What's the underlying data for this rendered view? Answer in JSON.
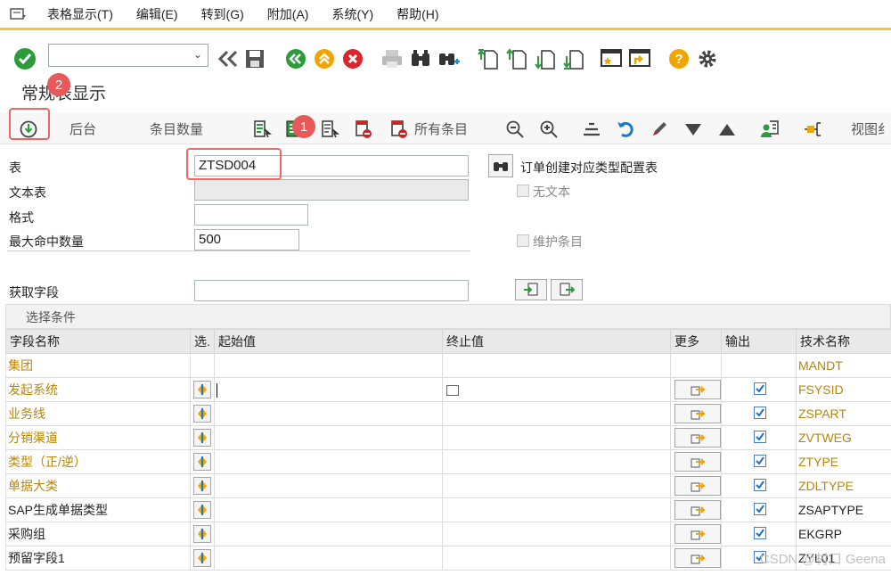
{
  "menu": {
    "items": [
      "表格显示(T)",
      "编辑(E)",
      "转到(G)",
      "附加(A)",
      "系统(Y)",
      "帮助(H)"
    ]
  },
  "toolbar": {
    "command_value": "",
    "icons": [
      "enter-icon",
      "back-icon",
      "save-icon",
      "green-back-icon",
      "exit-icon",
      "cancel-icon",
      "print-icon",
      "find-icon",
      "find-next-icon",
      "first-page-icon",
      "prev-page-icon",
      "next-page-icon",
      "last-page-icon",
      "new-session-icon",
      "shortcut-icon",
      "help-icon",
      "settings-icon"
    ]
  },
  "page_title": "常规表显示",
  "app_toolbar": {
    "background": "后台",
    "entry_count": "条目数量",
    "all_entries": "所有条目",
    "layout": "视图纟"
  },
  "form": {
    "table_label": "表",
    "table_value": "ZTSD004",
    "table_desc": "订单创建对应类型配置表",
    "text_table_label": "文本表",
    "text_table_value": "",
    "no_text_label": "无文本",
    "layout_label": "格式",
    "layout_value": "",
    "max_hits_label": "最大命中数量",
    "max_hits_value": "500",
    "maintain_label": "维护条目",
    "fetch_fields_label": "获取字段",
    "fetch_fields_value": ""
  },
  "badges": {
    "one": "1",
    "two": "2"
  },
  "selection": {
    "title": "选择条件",
    "headers": {
      "field_name": "字段名称",
      "sel": "选.",
      "from": "起始值",
      "to": "终止值",
      "more": "更多",
      "output": "输出",
      "tech_name": "技术名称"
    },
    "rows": [
      {
        "field": "集团",
        "tech": "MANDT",
        "req": true,
        "has_controls": false
      },
      {
        "field": "发起系统",
        "tech": "FSYSID",
        "req": true,
        "has_controls": true
      },
      {
        "field": "业务线",
        "tech": "ZSPART",
        "req": true,
        "has_controls": true
      },
      {
        "field": "分销渠道",
        "tech": "ZVTWEG",
        "req": true,
        "has_controls": true
      },
      {
        "field": "类型（正/逆）",
        "tech": "ZTYPE",
        "req": true,
        "has_controls": true
      },
      {
        "field": "单据大类",
        "tech": "ZDLTYPE",
        "req": true,
        "has_controls": true
      },
      {
        "field": "SAP生成单据类型",
        "tech": "ZSAPTYPE",
        "req": false,
        "has_controls": true
      },
      {
        "field": "采购组",
        "tech": "EKGRP",
        "req": false,
        "has_controls": true
      },
      {
        "field": "预留字段1",
        "tech": "ZYL01",
        "req": false,
        "has_controls": true
      }
    ]
  },
  "watermark": "CSDN @村口 Geena",
  "colors": {
    "accent_yellow": "#f0c24a",
    "required_field": "#b8860b",
    "annotation_red": "#e85a5a",
    "checkbox_blue": "#1f6fc2"
  }
}
